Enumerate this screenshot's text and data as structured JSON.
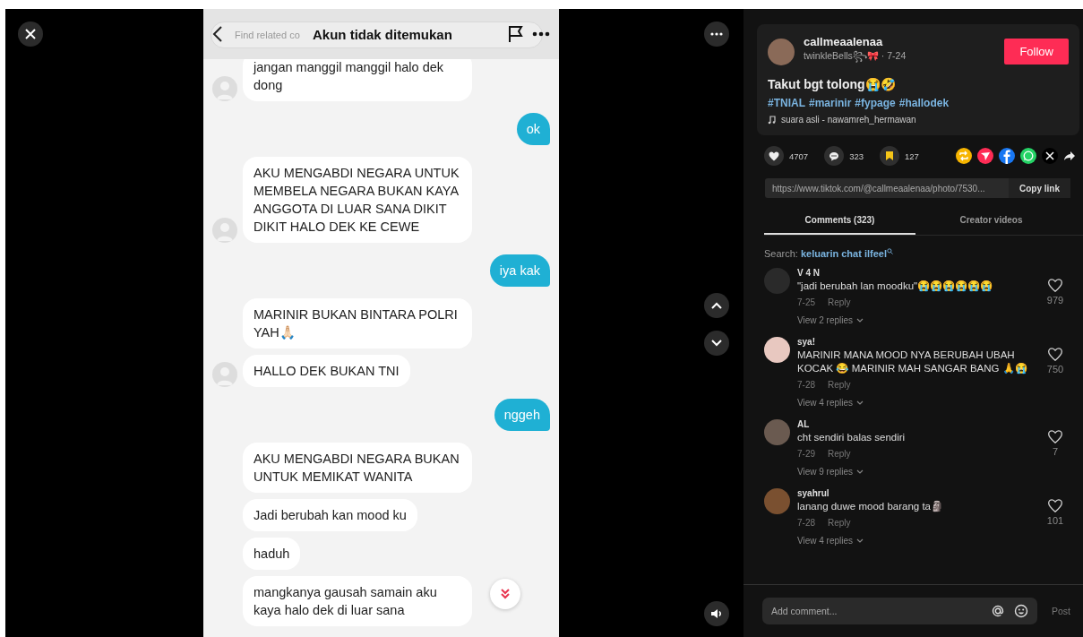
{
  "chat": {
    "title": "Akun tidak ditemukan",
    "search_placeholder": "Find related co",
    "messages": [
      {
        "kind": "received",
        "avatar": true,
        "text": "jangan manggil manggil halo dek dong"
      },
      {
        "kind": "sent",
        "text": "ok"
      },
      {
        "kind": "received",
        "avatar": true,
        "text": "AKU MENGABDI NEGARA UNTUK MEMBELA NEGARA BUKAN KAYA ANGGOTA DI LUAR SANA DIKIT DIKIT HALO DEK KE CEWE"
      },
      {
        "kind": "sent",
        "text": "iya kak"
      },
      {
        "kind": "received",
        "avatar": false,
        "text": "MARINIR BUKAN BINTARA POLRI YAH🙏🏻"
      },
      {
        "kind": "received",
        "avatar": true,
        "text": "HALLO DEK BUKAN TNI"
      },
      {
        "kind": "sent",
        "text": "nggeh"
      },
      {
        "kind": "received",
        "avatar": false,
        "text": "AKU MENGABDI NEGARA BUKAN UNTUK MEMIKAT WANITA"
      },
      {
        "kind": "received",
        "avatar": false,
        "text": "Jadi berubah kan mood ku"
      },
      {
        "kind": "received",
        "avatar": false,
        "text": "haduh"
      },
      {
        "kind": "received",
        "avatar": false,
        "text": "mangkanya gausah samain aku kaya halo dek di luar sana"
      }
    ]
  },
  "post": {
    "username": "callmeaalenaa",
    "nickname": "twinkleBells꧂🎀",
    "separator": "·",
    "date": "7-24",
    "follow": "Follow",
    "caption": "Takut bgt tolong😭🤣",
    "hashtags": [
      "#TNIAL",
      "#marinir",
      "#fypage",
      "#hallodek"
    ],
    "music": "suara asli - nawamreh_hermawan",
    "likes": "4707",
    "comments": "323",
    "saves": "127",
    "link": "https://www.tiktok.com/@callmeaalenaa/photo/7530...",
    "copy_link": "Copy link"
  },
  "tabs": [
    {
      "label": "Comments (323)",
      "selected": true
    },
    {
      "label": "Creator videos",
      "selected": false
    }
  ],
  "search": {
    "label": "Search:",
    "query": "keluarin chat ilfeel"
  },
  "comments": [
    {
      "user": "V 4 N",
      "text": "\"jadi berubah lan moodku\"😭😭😭😭😭😭",
      "date": "7-25",
      "reply": "Reply",
      "likes": "979",
      "replies": "View 2 replies",
      "color": "#2a2a2a"
    },
    {
      "user": "sya!",
      "text": "MARINIR MANA MOOD NYA BERUBAH UBAH KOCAK 😂 MARINIR MAH SANGAR BANG 🙏😭",
      "date": "7-28",
      "reply": "Reply",
      "likes": "750",
      "replies": "View 4 replies",
      "color": "#e8c8c0"
    },
    {
      "user": "AL",
      "text": "cht sendiri balas sendiri",
      "date": "7-29",
      "reply": "Reply",
      "likes": "7",
      "replies": "View 9 replies",
      "color": "#6a5a50"
    },
    {
      "user": "syahrul",
      "text": "lanang duwe mood barang ta🗿",
      "date": "7-28",
      "reply": "Reply",
      "likes": "101",
      "replies": "View 4 replies",
      "color": "#7a5030"
    }
  ],
  "composer": {
    "placeholder": "Add comment...",
    "post": "Post"
  }
}
